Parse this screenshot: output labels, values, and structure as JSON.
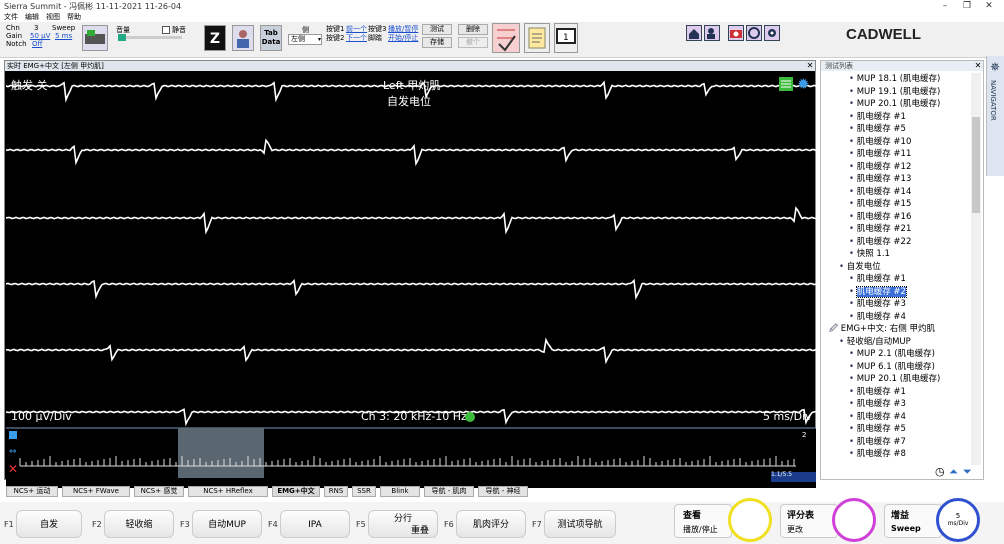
{
  "window": {
    "title": "Sierra Summit - 冯佩彬 11-11-2021 11-26-04"
  },
  "menu": [
    "文件",
    "编辑",
    "视图",
    "帮助"
  ],
  "toolbar": {
    "chn_label": "Chn",
    "chn_value": "3",
    "sweep_label": "Sweep",
    "sweep_value": "5 ms",
    "gain_label": "Gain",
    "gain_value": "50 μV",
    "notch_label": "Notch",
    "notch_value": "Off",
    "volume_label": "音量",
    "mute_label": "静音",
    "side_label": "侧",
    "side_value": "左侧",
    "key1_label": "按键1",
    "key1_action": "前一个",
    "key2_label": "按键2",
    "key2_action": "下一个",
    "key3_label": "按键3",
    "key3_action": "播放/暂停",
    "pedal_label": "脚踏",
    "pedal_action": "开始/停止",
    "test_btn": "测试",
    "delete_btn": "删除",
    "store_btn": "存储",
    "undo_btn": "撤个",
    "tabdata": "Tab Data",
    "logo": "CADWELL"
  },
  "trace_window": {
    "header": "实时 EMG+中文 [左侧 甲灼肌]",
    "trigger": "触发 关",
    "muscle": "Left 甲灼肌",
    "mode": "自发电位",
    "scale": "100 μV/Div",
    "channel": "Ch 3: 20 kHz-10 Hz",
    "timebase": "5 ms/Div",
    "strip_page": "2",
    "strip_ratio": "1.1/5.5"
  },
  "side_panel": {
    "header": "测试列表",
    "items": [
      {
        "label": "MUP 18.1 (肌电缓存)",
        "level": 2
      },
      {
        "label": "MUP 19.1 (肌电缓存)",
        "level": 2
      },
      {
        "label": "MUP 20.1 (肌电缓存)",
        "level": 2
      },
      {
        "label": "肌电缓存 #1",
        "level": 2
      },
      {
        "label": "肌电缓存 #5",
        "level": 2
      },
      {
        "label": "肌电缓存 #10",
        "level": 2
      },
      {
        "label": "肌电缓存 #11",
        "level": 2
      },
      {
        "label": "肌电缓存 #12",
        "level": 2
      },
      {
        "label": "肌电缓存 #13",
        "level": 2
      },
      {
        "label": "肌电缓存 #14",
        "level": 2
      },
      {
        "label": "肌电缓存 #15",
        "level": 2
      },
      {
        "label": "肌电缓存 #16",
        "level": 2
      },
      {
        "label": "肌电缓存 #21",
        "level": 2
      },
      {
        "label": "肌电缓存 #22",
        "level": 2
      },
      {
        "label": "快照 1.1",
        "level": 2
      },
      {
        "label": "自发电位",
        "level": 1
      },
      {
        "label": "肌电缓存 #1",
        "level": 2
      },
      {
        "label": "肌电缓存 #2",
        "level": 2,
        "selected": true
      },
      {
        "label": "肌电缓存 #3",
        "level": 2
      },
      {
        "label": "肌电缓存 #4",
        "level": 2
      },
      {
        "label": "EMG+中文: 右侧 甲灼肌",
        "level": 0
      },
      {
        "label": "轻收缩/自动MUP",
        "level": 1
      },
      {
        "label": "MUP 2.1 (肌电缓存)",
        "level": 2
      },
      {
        "label": "MUP 6.1 (肌电缓存)",
        "level": 2
      },
      {
        "label": "MUP 20.1 (肌电缓存)",
        "level": 2
      },
      {
        "label": "肌电缓存 #1",
        "level": 2
      },
      {
        "label": "肌电缓存 #3",
        "level": 2
      },
      {
        "label": "肌电缓存 #4",
        "level": 2
      },
      {
        "label": "肌电缓存 #5",
        "level": 2
      },
      {
        "label": "肌电缓存 #7",
        "level": 2
      },
      {
        "label": "肌电缓存 #8",
        "level": 2
      }
    ],
    "navigator": "NAVIGATOR"
  },
  "mode_tabs": [
    "NCS+ 运动",
    "NCS+ FWave",
    "NCS+ 感觉",
    "NCS+ HReflex",
    "EMG+中文",
    "RNS",
    "SSR",
    "Blink",
    "导航 - 肌肉",
    "导航 - 神经"
  ],
  "fkeys": [
    {
      "key": "F1",
      "label": "自发"
    },
    {
      "key": "F2",
      "label": "轻收缩"
    },
    {
      "key": "F3",
      "label": "自动MUP"
    },
    {
      "key": "F4",
      "label": "IPA"
    },
    {
      "key": "F5",
      "label": "分行",
      "label2": "重叠"
    },
    {
      "key": "F6",
      "label": "肌肉评分"
    },
    {
      "key": "F7",
      "label": "测试项导航"
    }
  ],
  "knobs": {
    "review": "查看",
    "play": "播放/停止",
    "score": "评分表",
    "change": "更改",
    "gain": "增益",
    "sweep": "Sweep",
    "sweep_value": "5",
    "sweep_unit": "ms/Div"
  }
}
